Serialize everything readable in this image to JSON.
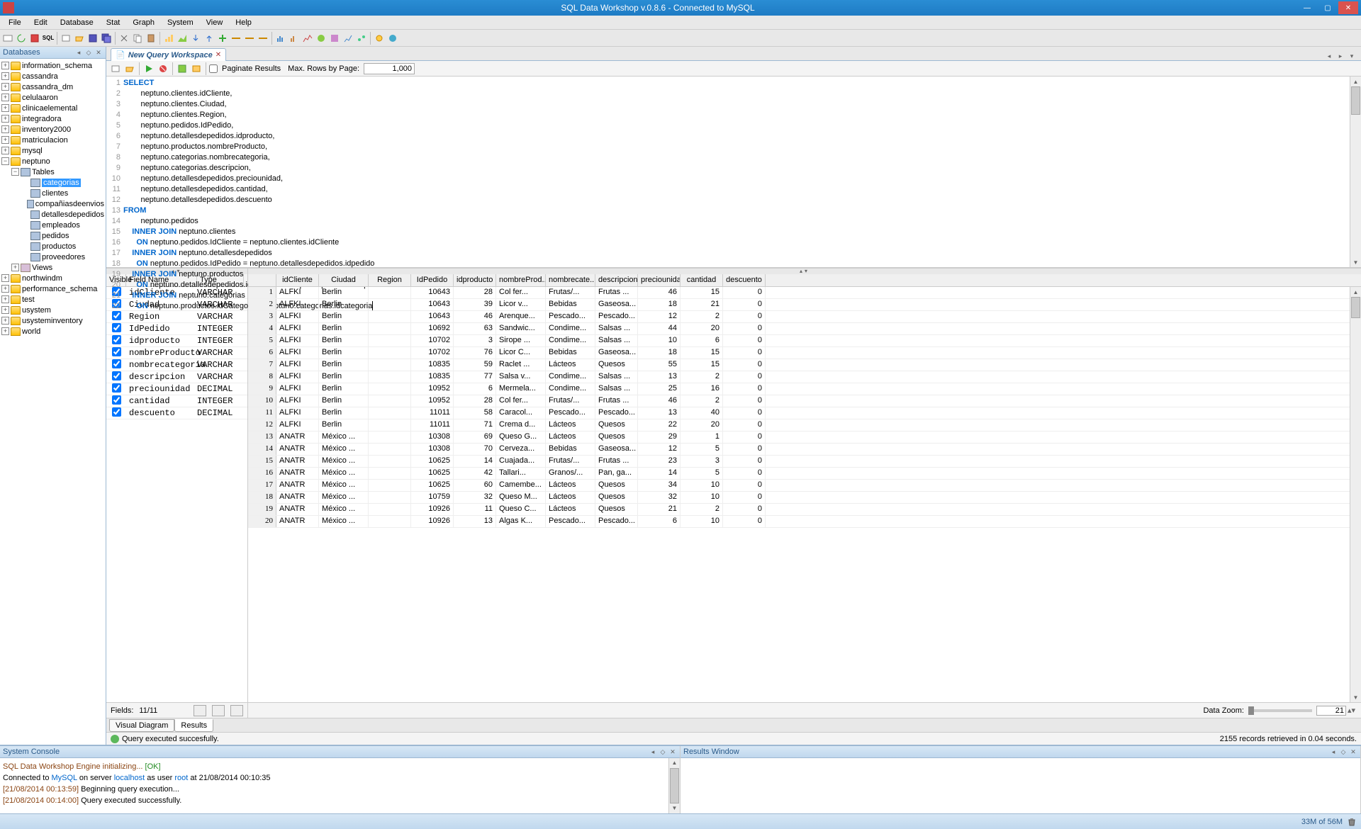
{
  "titlebar": {
    "title": "SQL Data Workshop v.0.8.6 - Connected to MySQL"
  },
  "menu": [
    "File",
    "Edit",
    "Database",
    "Stat",
    "Graph",
    "System",
    "View",
    "Help"
  ],
  "leftpanel": {
    "title": "Databases",
    "databases": [
      {
        "name": "information_schema",
        "open": false
      },
      {
        "name": "cassandra",
        "open": false
      },
      {
        "name": "cassandra_dm",
        "open": false
      },
      {
        "name": "celulaaron",
        "open": false
      },
      {
        "name": "clinicaelemental",
        "open": false
      },
      {
        "name": "integradora",
        "open": false
      },
      {
        "name": "inventory2000",
        "open": false
      },
      {
        "name": "matriculacion",
        "open": false
      },
      {
        "name": "mysql",
        "open": false
      },
      {
        "name": "neptuno",
        "open": true
      }
    ],
    "neptuno_tables_label": "Tables",
    "neptuno_tables": [
      "categorias",
      "clientes",
      "compañiasdeenvios",
      "detallesdepedidos",
      "empleados",
      "pedidos",
      "productos",
      "proveedores"
    ],
    "neptuno_views_label": "Views",
    "rest_databases": [
      {
        "name": "northwindm"
      },
      {
        "name": "performance_schema"
      },
      {
        "name": "test"
      },
      {
        "name": "usystem"
      },
      {
        "name": "usysteminventory"
      },
      {
        "name": "world"
      }
    ]
  },
  "querytab": {
    "label": "New Query Workspace"
  },
  "querytoolbar": {
    "paginate_label": "Paginate Results",
    "maxrows_label": "Max. Rows by Page:",
    "maxrows_value": "1,000"
  },
  "sql": [
    {
      "n": 1,
      "t": "SELECT",
      "kw": true
    },
    {
      "n": 2,
      "t": "        neptuno.clientes.idCliente,"
    },
    {
      "n": 3,
      "t": "        neptuno.clientes.Ciudad,"
    },
    {
      "n": 4,
      "t": "        neptuno.clientes.Region,"
    },
    {
      "n": 5,
      "t": "        neptuno.pedidos.IdPedido,"
    },
    {
      "n": 6,
      "t": "        neptuno.detallesdepedidos.idproducto,"
    },
    {
      "n": 7,
      "t": "        neptuno.productos.nombreProducto,"
    },
    {
      "n": 8,
      "t": "        neptuno.categorias.nombrecategoria,"
    },
    {
      "n": 9,
      "t": "        neptuno.categorias.descripcion,"
    },
    {
      "n": 10,
      "t": "        neptuno.detallesdepedidos.preciounidad,"
    },
    {
      "n": 11,
      "t": "        neptuno.detallesdepedidos.cantidad,"
    },
    {
      "n": 12,
      "t": "        neptuno.detallesdepedidos.descuento"
    },
    {
      "n": 13,
      "t": "FROM",
      "kw": true
    },
    {
      "n": 14,
      "t": "        neptuno.pedidos"
    },
    {
      "n": 15,
      "t": "    INNER JOIN neptuno.clientes",
      "kw2": "INNER JOIN"
    },
    {
      "n": 16,
      "t": "      ON neptuno.pedidos.IdCliente = neptuno.clientes.idCliente",
      "kw2": "ON"
    },
    {
      "n": 17,
      "t": "    INNER JOIN neptuno.detallesdepedidos",
      "kw2": "INNER JOIN"
    },
    {
      "n": 18,
      "t": "      ON neptuno.pedidos.IdPedido = neptuno.detallesdepedidos.idpedido",
      "kw2": "ON"
    },
    {
      "n": 19,
      "t": "    INNER JOIN neptuno.productos",
      "kw2": "INNER JOIN"
    },
    {
      "n": 20,
      "t": "      ON neptuno.detallesdepedidos.idproducto = neptuno.productos.idproducto",
      "kw2": "ON"
    },
    {
      "n": 21,
      "t": "    INNER JOIN neptuno.categorias",
      "kw2": "INNER JOIN"
    },
    {
      "n": 22,
      "t": "      ON neptuno.productos.idCategoria = neptuno.categorias.idcategoria",
      "kw2": "ON",
      "cursor": true
    }
  ],
  "fields": {
    "header": {
      "visible": "Visible",
      "name": "Field Name",
      "type": "Type"
    },
    "rows": [
      {
        "name": "idCliente",
        "type": "VARCHAR"
      },
      {
        "name": "Ciudad",
        "type": "VARCHAR"
      },
      {
        "name": "Region",
        "type": "VARCHAR"
      },
      {
        "name": "IdPedido",
        "type": "INTEGER"
      },
      {
        "name": "idproducto",
        "type": "INTEGER"
      },
      {
        "name": "nombreProducto",
        "type": "VARCHAR"
      },
      {
        "name": "nombrecategoria",
        "type": "VARCHAR"
      },
      {
        "name": "descripcion",
        "type": "VARCHAR"
      },
      {
        "name": "preciounidad",
        "type": "DECIMAL"
      },
      {
        "name": "cantidad",
        "type": "INTEGER"
      },
      {
        "name": "descuento",
        "type": "DECIMAL"
      }
    ],
    "footer_label": "Fields:",
    "footer_count": "11/11"
  },
  "grid": {
    "columns": [
      "idCliente",
      "Ciudad",
      "Region",
      "IdPedido",
      "idproducto",
      "nombreProd...",
      "nombrecate...",
      "descripcion",
      "preciounidad",
      "cantidad",
      "descuento"
    ],
    "rows": [
      {
        "n": 1,
        "c": [
          "ALFKI",
          "Berlin",
          "",
          "10643",
          "28",
          "Col fer...",
          "Frutas/...",
          "Frutas ...",
          "46",
          "15",
          "0"
        ]
      },
      {
        "n": 2,
        "c": [
          "ALFKI",
          "Berlin",
          "",
          "10643",
          "39",
          "Licor v...",
          "Bebidas",
          "Gaseosa...",
          "18",
          "21",
          "0"
        ]
      },
      {
        "n": 3,
        "c": [
          "ALFKI",
          "Berlin",
          "",
          "10643",
          "46",
          "Arenque...",
          "Pescado...",
          "Pescado...",
          "12",
          "2",
          "0"
        ]
      },
      {
        "n": 4,
        "c": [
          "ALFKI",
          "Berlin",
          "",
          "10692",
          "63",
          "Sandwic...",
          "Condime...",
          "Salsas ...",
          "44",
          "20",
          "0"
        ]
      },
      {
        "n": 5,
        "c": [
          "ALFKI",
          "Berlin",
          "",
          "10702",
          "3",
          "Sirope ...",
          "Condime...",
          "Salsas ...",
          "10",
          "6",
          "0"
        ]
      },
      {
        "n": 6,
        "c": [
          "ALFKI",
          "Berlin",
          "",
          "10702",
          "76",
          "Licor C...",
          "Bebidas",
          "Gaseosa...",
          "18",
          "15",
          "0"
        ]
      },
      {
        "n": 7,
        "c": [
          "ALFKI",
          "Berlin",
          "",
          "10835",
          "59",
          "Raclet ...",
          "Lácteos",
          "Quesos",
          "55",
          "15",
          "0"
        ]
      },
      {
        "n": 8,
        "c": [
          "ALFKI",
          "Berlin",
          "",
          "10835",
          "77",
          "Salsa v...",
          "Condime...",
          "Salsas ...",
          "13",
          "2",
          "0"
        ]
      },
      {
        "n": 9,
        "c": [
          "ALFKI",
          "Berlin",
          "",
          "10952",
          "6",
          "Mermela...",
          "Condime...",
          "Salsas ...",
          "25",
          "16",
          "0"
        ]
      },
      {
        "n": 10,
        "c": [
          "ALFKI",
          "Berlin",
          "",
          "10952",
          "28",
          "Col fer...",
          "Frutas/...",
          "Frutas ...",
          "46",
          "2",
          "0"
        ]
      },
      {
        "n": 11,
        "c": [
          "ALFKI",
          "Berlin",
          "",
          "11011",
          "58",
          "Caracol...",
          "Pescado...",
          "Pescado...",
          "13",
          "40",
          "0"
        ]
      },
      {
        "n": 12,
        "c": [
          "ALFKI",
          "Berlin",
          "",
          "11011",
          "71",
          "Crema d...",
          "Lácteos",
          "Quesos",
          "22",
          "20",
          "0"
        ]
      },
      {
        "n": 13,
        "c": [
          "ANATR",
          "México ...",
          "",
          "10308",
          "69",
          "Queso G...",
          "Lácteos",
          "Quesos",
          "29",
          "1",
          "0"
        ]
      },
      {
        "n": 14,
        "c": [
          "ANATR",
          "México ...",
          "",
          "10308",
          "70",
          "Cerveza...",
          "Bebidas",
          "Gaseosa...",
          "12",
          "5",
          "0"
        ]
      },
      {
        "n": 15,
        "c": [
          "ANATR",
          "México ...",
          "",
          "10625",
          "14",
          "Cuajada...",
          "Frutas/...",
          "Frutas ...",
          "23",
          "3",
          "0"
        ]
      },
      {
        "n": 16,
        "c": [
          "ANATR",
          "México ...",
          "",
          "10625",
          "42",
          "Tallari...",
          "Granos/...",
          "Pan, ga...",
          "14",
          "5",
          "0"
        ]
      },
      {
        "n": 17,
        "c": [
          "ANATR",
          "México ...",
          "",
          "10625",
          "60",
          "Camembe...",
          "Lácteos",
          "Quesos",
          "34",
          "10",
          "0"
        ]
      },
      {
        "n": 18,
        "c": [
          "ANATR",
          "México ...",
          "",
          "10759",
          "32",
          "Queso M...",
          "Lácteos",
          "Quesos",
          "32",
          "10",
          "0"
        ]
      },
      {
        "n": 19,
        "c": [
          "ANATR",
          "México ...",
          "",
          "10926",
          "11",
          "Queso C...",
          "Lácteos",
          "Quesos",
          "21",
          "2",
          "0"
        ]
      },
      {
        "n": 20,
        "c": [
          "ANATR",
          "México ...",
          "",
          "10926",
          "13",
          "Algas K...",
          "Pescado...",
          "Pescado...",
          "6",
          "10",
          "0"
        ]
      }
    ],
    "zoom_label": "Data Zoom:",
    "zoom_value": "21"
  },
  "bottomtabs": {
    "visual": "Visual Diagram",
    "results": "Results"
  },
  "status": {
    "ok_text": "Query executed succesfully.",
    "rec_text": "2155 records retrieved in 0.04 seconds."
  },
  "console": {
    "title": "System Console",
    "lines": [
      {
        "pre": "SQL Data Workshop Engine initializing... ",
        "tail": "[OK]",
        "cls": "cb-brown",
        "tail_cls": "cb-green"
      },
      {
        "pre": "Connected to ",
        "a": "MySQL",
        "mid": " on server ",
        "b": "localhost",
        "mid2": " as user ",
        "c": "root",
        "tail": " at 21/08/2014 00:10:35"
      },
      {
        "ts": "[21/08/2014 00:13:59] ",
        "txt": "Beginning query execution..."
      },
      {
        "ts": "[21/08/2014 00:14:00] ",
        "txt": "Query executed successfully."
      }
    ]
  },
  "results_panel": {
    "title": "Results Window"
  },
  "appstatus": {
    "mem": "33M of 56M"
  }
}
